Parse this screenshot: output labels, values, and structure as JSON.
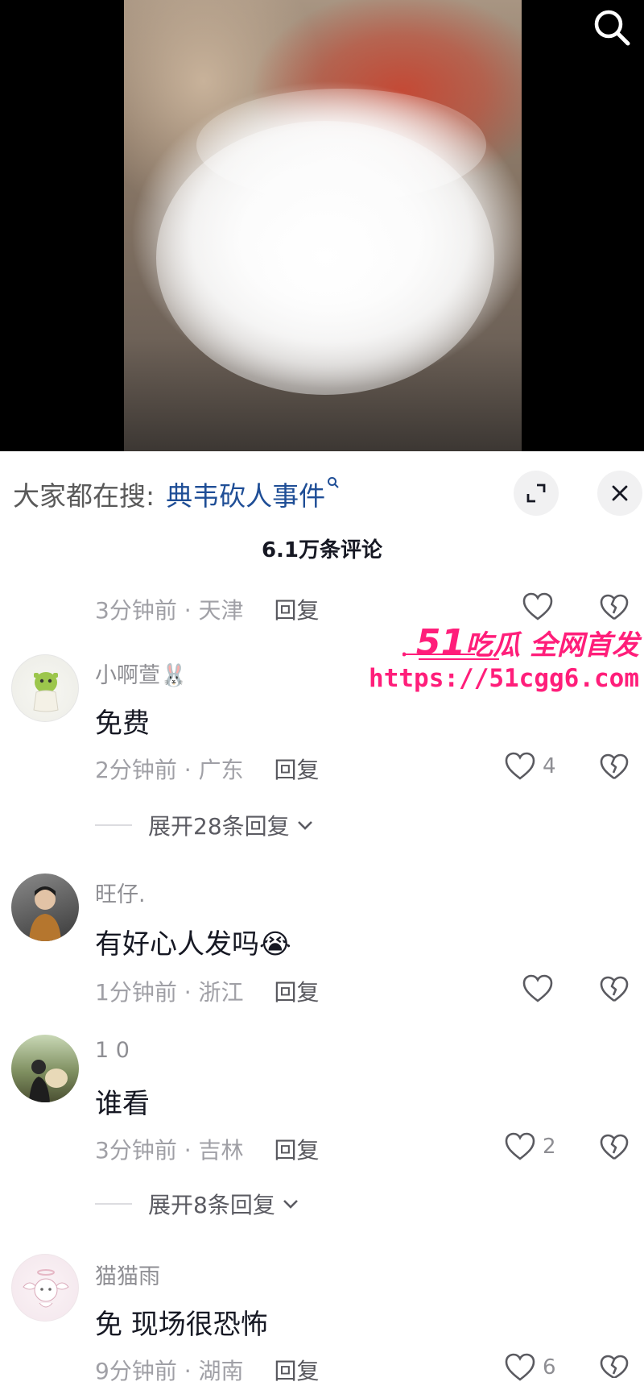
{
  "search_bar": {
    "prefix": "大家都在搜:",
    "term": "典韦砍人事件",
    "term_icon": "search-icon"
  },
  "comments_header": {
    "count": "6.1万条评论"
  },
  "comments": [
    {
      "time_location": "3分钟前 · 天津",
      "reply": "回复",
      "likes": ""
    },
    {
      "username": "小啊萱🐰",
      "content": "免费",
      "time_location": "2分钟前 · 广东",
      "reply": "回复",
      "likes": "4",
      "expand": "展开28条回复"
    },
    {
      "username": "旺仔.",
      "content": "有好心人发吗😭",
      "time_location": "1分钟前 · 浙江",
      "reply": "回复",
      "likes": ""
    },
    {
      "username": "1 0",
      "content": "谁看",
      "time_location": "3分钟前 · 吉林",
      "reply": "回复",
      "likes": "2",
      "expand": "展开8条回复"
    },
    {
      "username": "猫猫雨",
      "content": "免 现场很恐怖",
      "time_location": "9分钟前 · 湖南",
      "reply": "回复",
      "likes": "6"
    }
  ],
  "watermark": {
    "brand_num": "51",
    "brand_text": "吃瓜 全网首发",
    "url": "https://51cgg6.com"
  },
  "colors": {
    "link": "#1f4e96",
    "watermark": "#ff1e7a",
    "meta": "#a0a0a6"
  }
}
